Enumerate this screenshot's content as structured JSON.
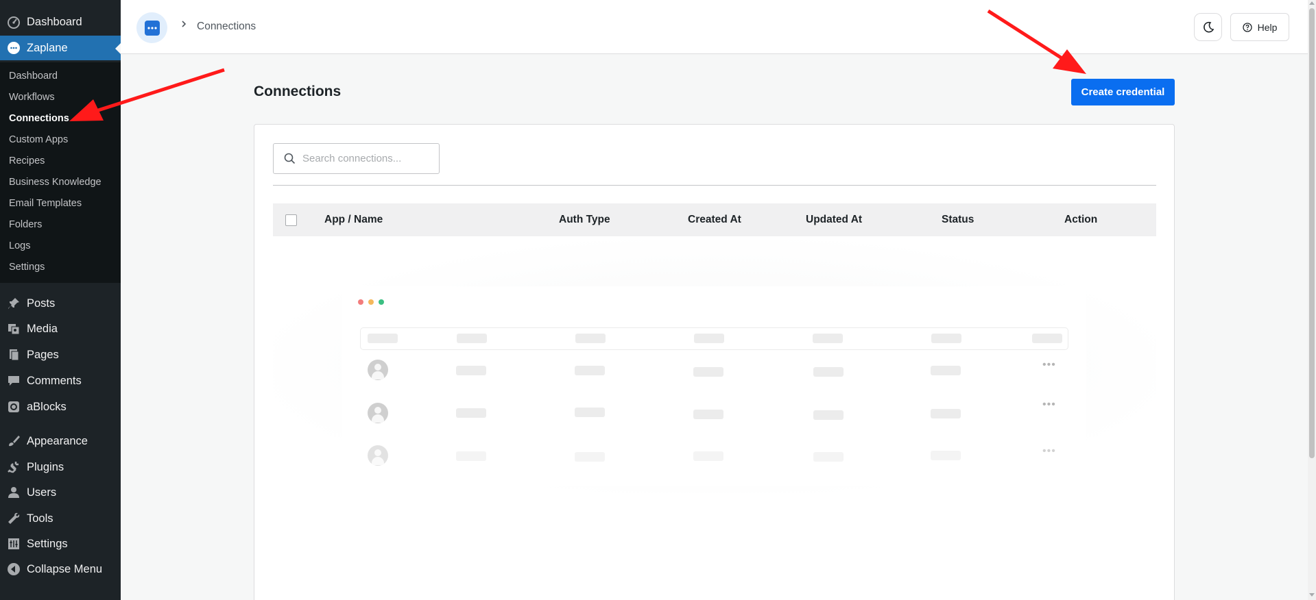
{
  "sidebar": {
    "top_items": [
      {
        "label": "Dashboard",
        "icon": "dashboard-icon"
      },
      {
        "label": "Zaplane",
        "icon": "zaplane-icon"
      }
    ],
    "submenu": [
      "Dashboard",
      "Workflows",
      "Connections",
      "Custom Apps",
      "Recipes",
      "Business Knowledge",
      "Email Templates",
      "Folders",
      "Logs",
      "Settings"
    ],
    "active_submenu": "Connections",
    "bottom_items": [
      {
        "label": "Posts",
        "icon": "pin-icon"
      },
      {
        "label": "Media",
        "icon": "media-icon"
      },
      {
        "label": "Pages",
        "icon": "pages-icon"
      },
      {
        "label": "Comments",
        "icon": "comment-icon"
      },
      {
        "label": "aBlocks",
        "icon": "ablocks-icon"
      },
      {
        "label": "Appearance",
        "icon": "brush-icon"
      },
      {
        "label": "Plugins",
        "icon": "plug-icon"
      },
      {
        "label": "Users",
        "icon": "user-icon"
      },
      {
        "label": "Tools",
        "icon": "wrench-icon"
      },
      {
        "label": "Settings",
        "icon": "sliders-icon"
      },
      {
        "label": "Collapse Menu",
        "icon": "collapse-icon"
      }
    ]
  },
  "header": {
    "breadcrumb": "Connections",
    "help_label": "Help"
  },
  "main": {
    "title": "Connections",
    "create_button": "Create credential",
    "search_placeholder": "Search connections...",
    "columns": [
      "App / Name",
      "Auth Type",
      "Created At",
      "Updated At",
      "Status",
      "Action"
    ]
  },
  "colors": {
    "admin_bg": "#1d2327",
    "submenu_bg": "#101517",
    "menu_current": "#2271b1",
    "primary_button": "#0a6ef0",
    "annotation_arrow": "#ff1a1a"
  }
}
